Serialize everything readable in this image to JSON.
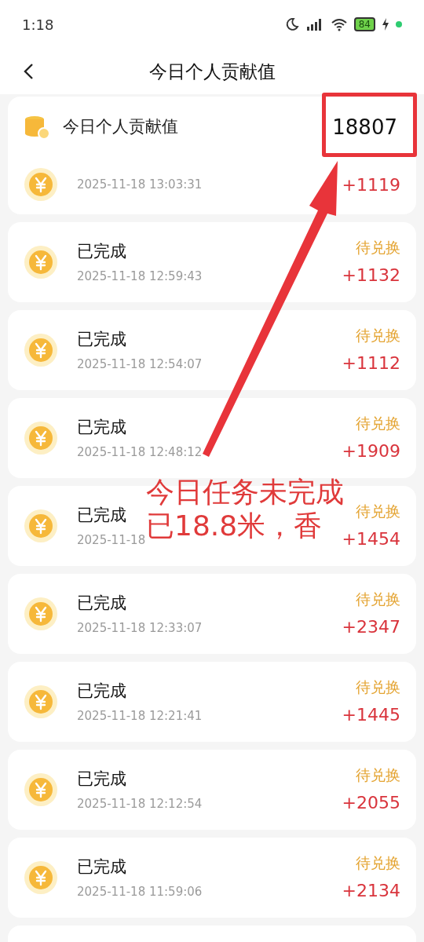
{
  "status_bar": {
    "time": "1:18",
    "battery": "84"
  },
  "nav": {
    "title": "今日个人贡献值"
  },
  "summary": {
    "label": "今日个人贡献值",
    "value": "18807"
  },
  "records": [
    {
      "datetime": "2025-11-18 13:03:31",
      "amount": "+1119"
    },
    {
      "title": "已完成",
      "datetime": "2025-11-18 12:59:43",
      "status": "待兑换",
      "amount": "+1132"
    },
    {
      "title": "已完成",
      "datetime": "2025-11-18 12:54:07",
      "status": "待兑换",
      "amount": "+1112"
    },
    {
      "title": "已完成",
      "datetime": "2025-11-18 12:48:12",
      "status": "待兑换",
      "amount": "+1909"
    },
    {
      "title": "已完成",
      "datetime": "2025-11-18",
      "status": "待兑换",
      "amount": "+1454"
    },
    {
      "title": "已完成",
      "datetime": "2025-11-18 12:33:07",
      "status": "待兑换",
      "amount": "+2347"
    },
    {
      "title": "已完成",
      "datetime": "2025-11-18 12:21:41",
      "status": "待兑换",
      "amount": "+1445"
    },
    {
      "title": "已完成",
      "datetime": "2025-11-18 12:12:54",
      "status": "待兑换",
      "amount": "+2055"
    },
    {
      "title": "已完成",
      "datetime": "2025-11-18 11:59:06",
      "status": "待兑换",
      "amount": "+2134"
    }
  ],
  "annotation": {
    "lines": [
      "今日任务未完成",
      "已18.8米，香"
    ]
  }
}
